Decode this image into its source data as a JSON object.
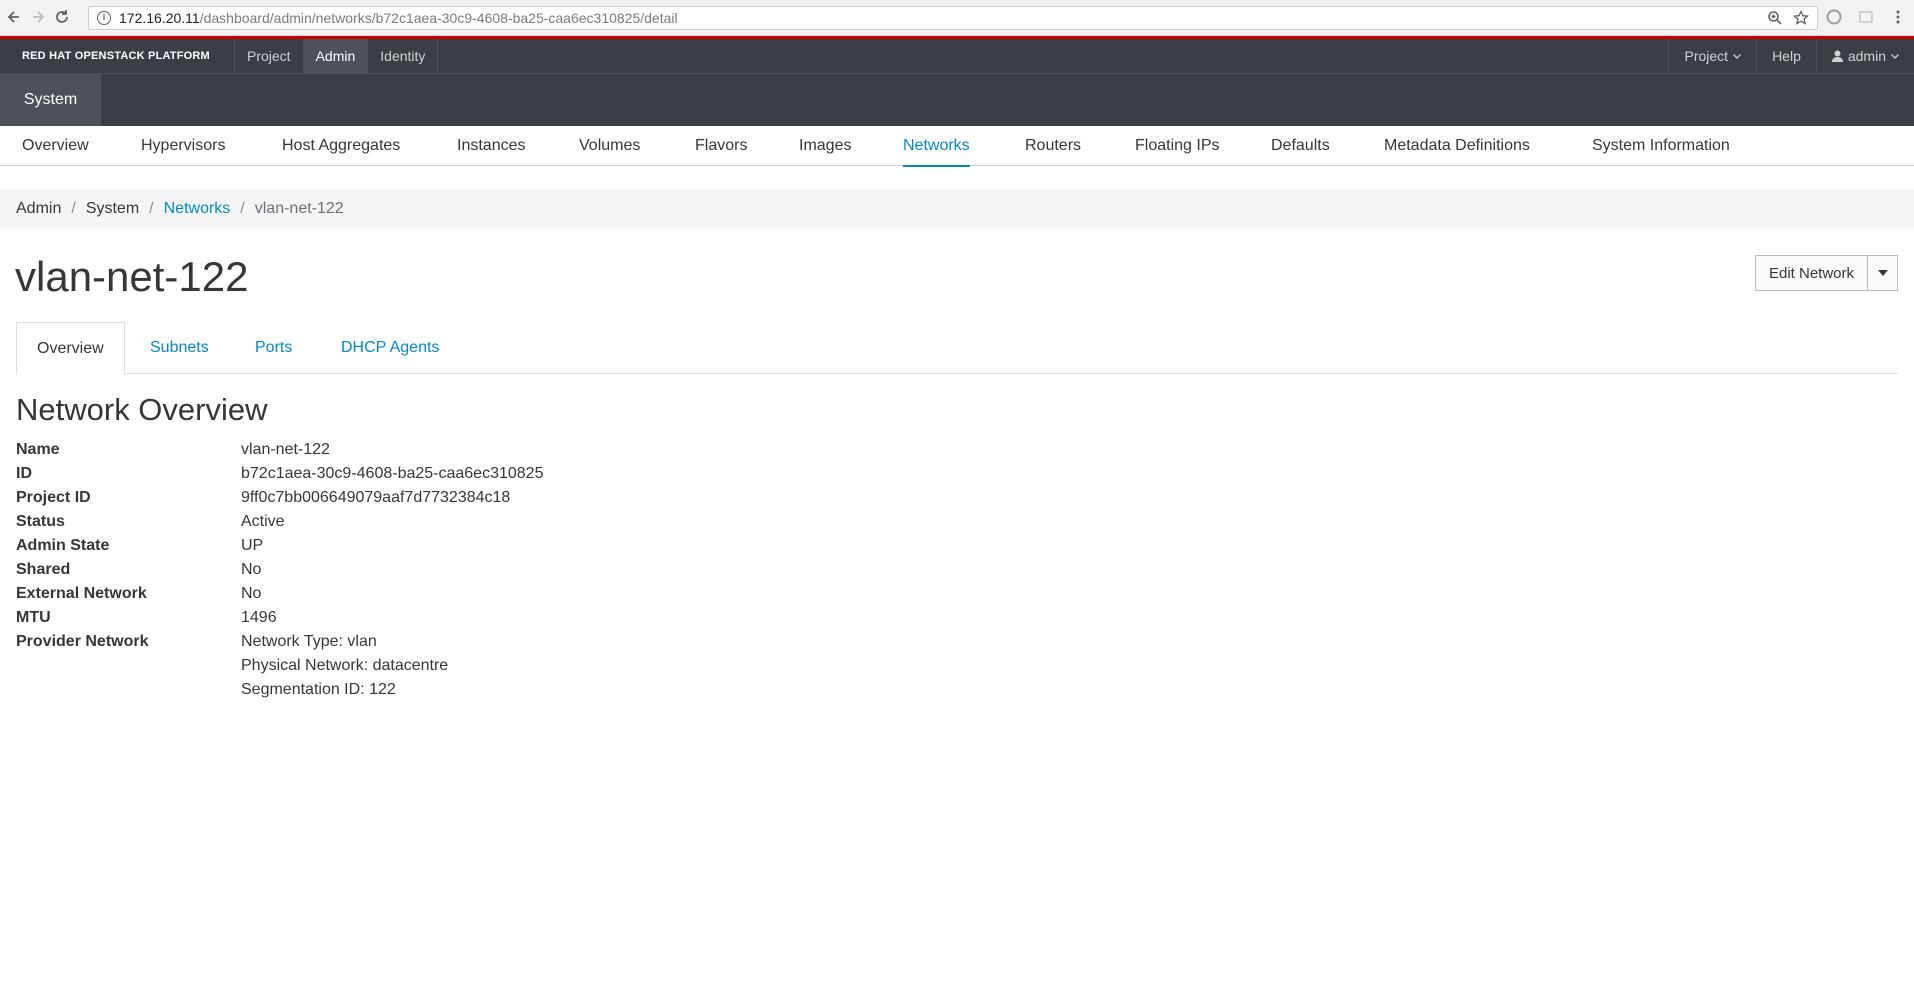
{
  "browser": {
    "url_host": "172.16.20.11",
    "url_path": "/dashboard/admin/networks/b72c1aea-30c9-4608-ba25-caa6ec310825/detail"
  },
  "topbar": {
    "brand": "RED HAT OPENSTACK PLATFORM",
    "nav": [
      "Project",
      "Admin",
      "Identity"
    ],
    "active": "Admin",
    "right": {
      "project": "Project",
      "help": "Help",
      "user": "admin"
    }
  },
  "system_tab": "System",
  "subnav": {
    "items": [
      "Overview",
      "Hypervisors",
      "Host Aggregates",
      "Instances",
      "Volumes",
      "Flavors",
      "Images",
      "Networks",
      "Routers",
      "Floating IPs",
      "Defaults",
      "Metadata Definitions",
      "System Information"
    ],
    "active": "Networks"
  },
  "breadcrumb": [
    "Admin",
    "System",
    "Networks",
    "vlan-net-122"
  ],
  "page_title": "vlan-net-122",
  "actions": {
    "edit": "Edit Network"
  },
  "tabs": [
    "Overview",
    "Subnets",
    "Ports",
    "DHCP Agents"
  ],
  "overview": {
    "title": "Network Overview",
    "fields": [
      {
        "label": "Name",
        "value": "vlan-net-122"
      },
      {
        "label": "ID",
        "value": "b72c1aea-30c9-4608-ba25-caa6ec310825"
      },
      {
        "label": "Project ID",
        "value": "9ff0c7bb006649079aaf7d7732384c18"
      },
      {
        "label": "Status",
        "value": "Active"
      },
      {
        "label": "Admin State",
        "value": "UP"
      },
      {
        "label": "Shared",
        "value": "No"
      },
      {
        "label": "External Network",
        "value": "No"
      },
      {
        "label": "MTU",
        "value": "1496"
      },
      {
        "label": "Provider Network",
        "value": "Network Type: vlan"
      }
    ],
    "provider_extra": [
      "Physical Network: datacentre",
      "Segmentation ID: 122"
    ]
  },
  "colors": {
    "accent": "#0088ce",
    "navbar": "#393f44",
    "brand_red": "#cc0000"
  }
}
